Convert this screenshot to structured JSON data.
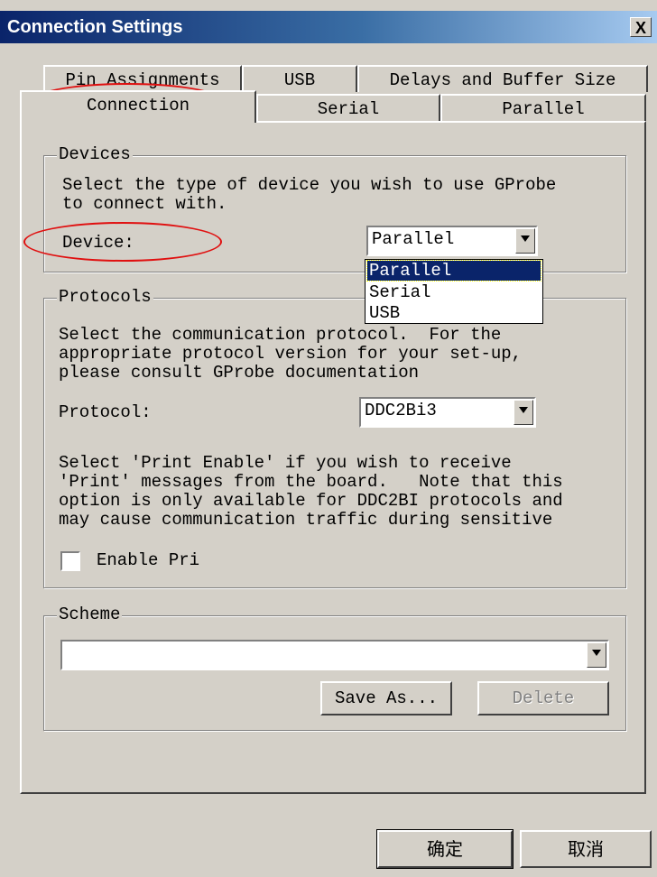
{
  "window": {
    "title": "Connection Settings",
    "close_label": "X"
  },
  "tabs": {
    "row1": [
      {
        "label": "Pin Assignments"
      },
      {
        "label": "USB"
      },
      {
        "label": "Delays and Buffer Size"
      }
    ],
    "row2": [
      {
        "label": "Connection",
        "active": true
      },
      {
        "label": "Serial"
      },
      {
        "label": "Parallel"
      }
    ]
  },
  "devices": {
    "group_label": "Devices",
    "description": "Select the type of device you wish to use GProbe\nto connect with.",
    "device_label": "Device:",
    "device_value": "Parallel",
    "dropdown_options": [
      "Parallel",
      "Serial",
      "USB"
    ],
    "dropdown_selected": "Parallel"
  },
  "protocols": {
    "group_label": "Protocols",
    "description": "Select the communication protocol.  For the\nappropriate protocol version for your set-up,\nplease consult GProbe documentation",
    "protocol_label": "Protocol:",
    "protocol_value": "DDC2Bi3",
    "print_description": "Select 'Print Enable' if you wish to receive\n'Print' messages from the board.   Note that this\noption is only available for DDC2BI protocols and\nmay cause communication traffic during sensitive",
    "checkbox_label": "Enable Pri",
    "checkbox_checked": false
  },
  "scheme": {
    "group_label": "Scheme",
    "value": "",
    "save_as_label": "Save As...",
    "delete_label": "Delete"
  },
  "footer": {
    "ok_label": "确定",
    "cancel_label": "取消"
  },
  "colors": {
    "title_bar": "#0a246a",
    "window_bg": "#d4d0c8",
    "highlight_ellipse": "#e01010",
    "selection": "#0a246a"
  }
}
